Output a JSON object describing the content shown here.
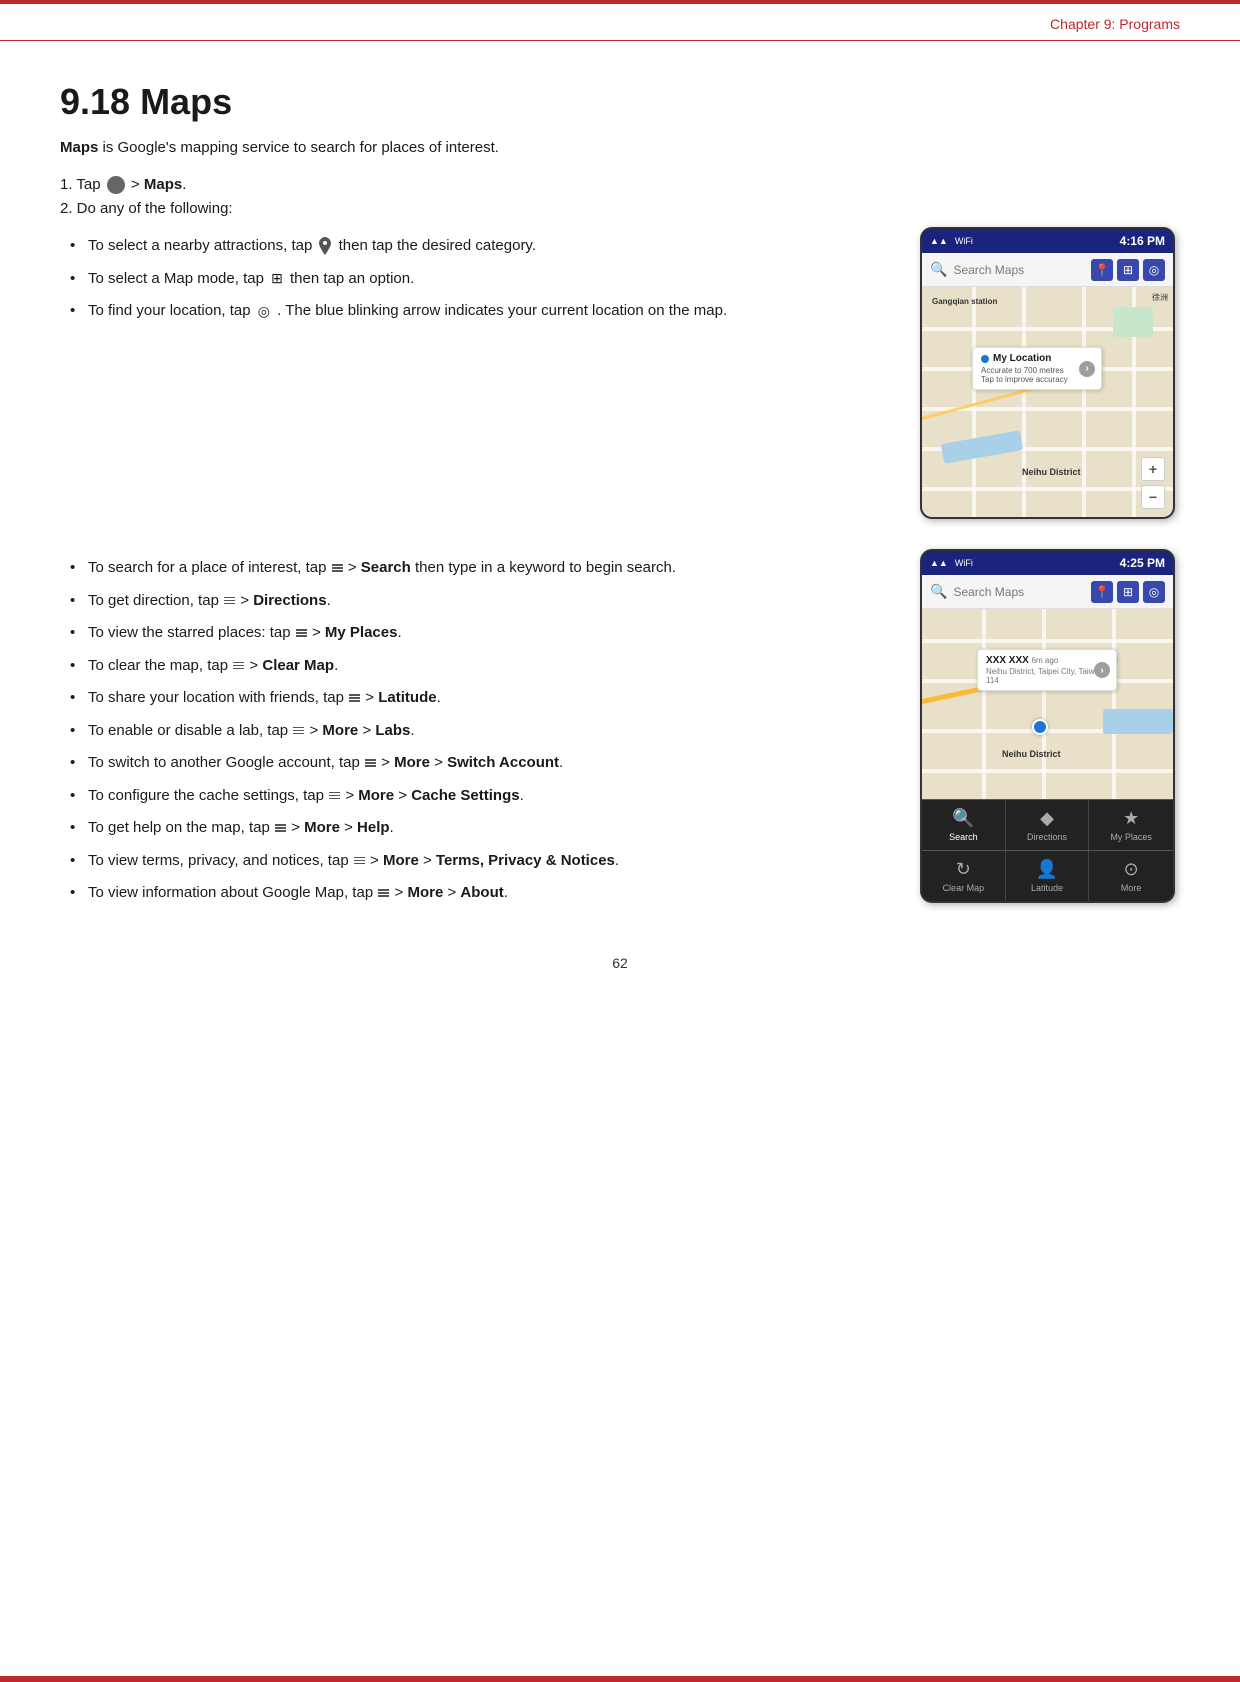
{
  "chapter_header": "Chapter 9:  Programs",
  "section_title": "9.18 Maps",
  "intro": {
    "text_before": "Maps",
    "text_after": " is Google's mapping service to search for places of interest."
  },
  "steps": [
    {
      "number": "1.",
      "text_before": "Tap",
      "text_bold": "",
      "text_after": "> Maps."
    },
    {
      "number": "2.",
      "text": "Do any of the following:"
    }
  ],
  "bullets_1": [
    {
      "text_before": "To select a nearby attractions, tap",
      "icon": "pin-icon",
      "text_after": " then tap the desired category."
    },
    {
      "text_before": "To select a Map mode, tap",
      "icon": "layers-icon",
      "text_after": " then tap an option."
    },
    {
      "text_before": "To find your location, tap",
      "icon": "location-icon",
      "text_after": ". The blue blinking arrow indicates your current location on the map."
    }
  ],
  "phone1": {
    "time": "4:16 PM",
    "search_placeholder": "Search Maps",
    "my_location_title": "My Location",
    "my_location_dot": "●",
    "my_location_line1": "Accurate to 700 metres",
    "my_location_line2": "Tap to improve accuracy",
    "district_label": "Neihu District"
  },
  "bullets_2": [
    {
      "text_before": "To search for a place of interest, tap",
      "icon": "menu-icon",
      "text_middle": " > ",
      "text_bold": "Search",
      "text_after": " then type in a keyword to begin search."
    },
    {
      "text_before": "To get direction, tap",
      "icon": "menu-icon",
      "text_middle": " > ",
      "text_bold": "Directions",
      "text_after": "."
    },
    {
      "text_before": "To view the starred places: tap",
      "icon": "menu-icon",
      "text_middle": " > ",
      "text_bold": "My Places",
      "text_after": "."
    },
    {
      "text_before": "To clear the map, tap",
      "icon": "menu-icon",
      "text_middle": " > ",
      "text_bold": "Clear Map",
      "text_after": "."
    },
    {
      "text_before": "To share your location with friends, tap",
      "icon": "menu-icon",
      "text_middle": " > ",
      "text_bold": "Latitude",
      "text_after": "."
    },
    {
      "text_before": "To enable or disable a lab, tap",
      "icon": "menu-icon",
      "text_middle": " > ",
      "text_bold": "More",
      "text_after": " > ",
      "text_bold2": "Labs",
      "text_after2": "."
    },
    {
      "text_before": "To switch to another Google account, tap",
      "icon": "menu-icon",
      "text_middle": " > ",
      "text_bold": "More",
      "text_after": " > ",
      "text_bold2": "Switch Account",
      "text_after2": "."
    },
    {
      "text_before": "To configure the cache settings, tap",
      "icon": "menu-icon",
      "text_middle": " > ",
      "text_bold": "More",
      "text_after": " > ",
      "text_bold2": "Cache Settings",
      "text_after2": "."
    },
    {
      "text_before": "To get help on the map, tap",
      "icon": "menu-icon",
      "text_middle": " > ",
      "text_bold": "More",
      "text_after": " > ",
      "text_bold2": "Help",
      "text_after2": "."
    },
    {
      "text_before": "To view terms, privacy, and notices, tap",
      "icon": "menu-icon",
      "text_middle": " > ",
      "text_bold": "More",
      "text_after": " > ",
      "text_bold2": "Terms, Privacy & Notices",
      "text_after2": "."
    },
    {
      "text_before": "To view information about Google Map, tap",
      "icon": "menu-icon",
      "text_middle": " > ",
      "text_bold": "More",
      "text_after": " > ",
      "text_bold2": "About",
      "text_after2": "."
    }
  ],
  "phone2": {
    "time": "4:25 PM",
    "search_placeholder": "Search Maps",
    "popup_title": "XXX XXX",
    "popup_time": "6m ago",
    "popup_subtitle": "Neihu District, Taipei City, Taiwan 114",
    "district_label": "Neihu District",
    "toolbar1": {
      "btn1_label": "Search",
      "btn1_icon": "🔍",
      "btn2_label": "Directions",
      "btn2_icon": "◆",
      "btn3_label": "My Places",
      "btn3_icon": "★"
    },
    "toolbar2": {
      "btn1_label": "Clear Map",
      "btn1_icon": "↻",
      "btn2_label": "Latitude",
      "btn2_icon": "👤",
      "btn3_label": "More",
      "btn3_icon": "⊙"
    }
  },
  "page_number": "62"
}
